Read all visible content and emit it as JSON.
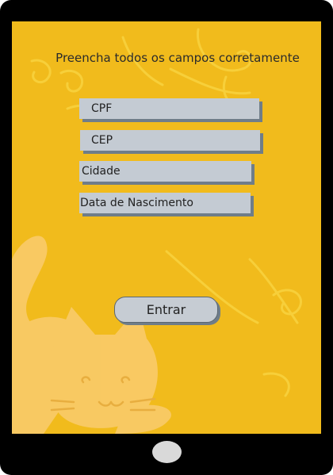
{
  "form": {
    "title": "Preencha todos os campos corretamente",
    "fields": [
      {
        "label": "CPF"
      },
      {
        "label": "CEP"
      },
      {
        "label": "Cidade"
      },
      {
        "label": "Data de Nascimento"
      }
    ],
    "submit_label": "Entrar"
  },
  "colors": {
    "screen_background": "#f1bb1c",
    "field_background": "#c4cbd3",
    "field_shadow": "#6f7d89",
    "device_frame": "#000000",
    "home_button": "#d9d9d9"
  },
  "icons": {
    "background": [
      "cat-illustration",
      "wind-swirl-decoration"
    ],
    "device": [
      "home-button"
    ]
  }
}
